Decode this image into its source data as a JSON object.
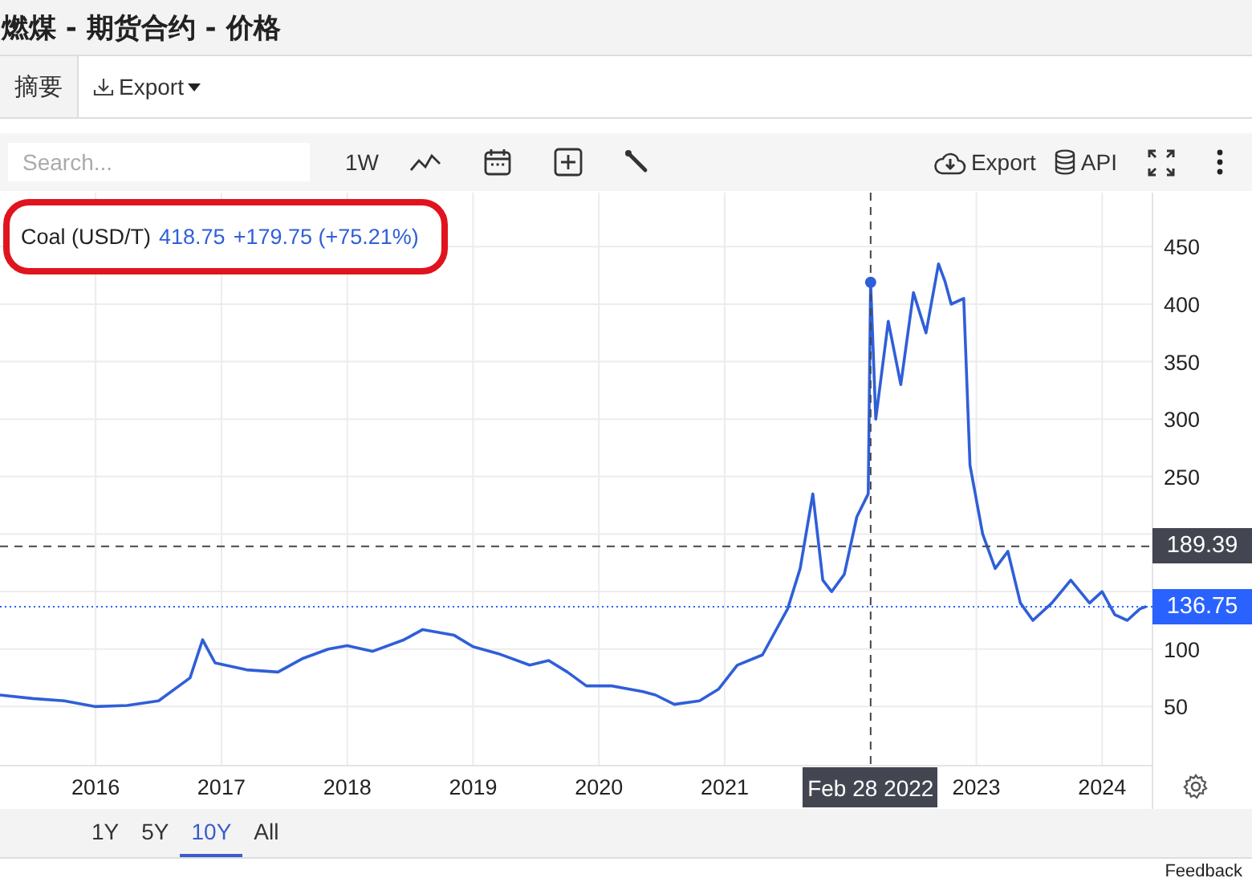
{
  "window": {
    "title": "燃煤 - 期货合约 - 价格"
  },
  "tabs": [
    {
      "label": "摘要",
      "selected": false
    },
    {
      "label": "Export",
      "kind": "dropdown",
      "selected": false
    }
  ],
  "toolbar": {
    "search": {
      "placeholder": "Search..."
    },
    "interval": "1W",
    "export": "Export",
    "api": "API"
  },
  "chart": {
    "legend": {
      "price": "418.75",
      "change": "+179.75 (+75.21%)",
      "highlighted": true
    },
    "chart_data": {
      "type": "line",
      "xlim": [
        2015.24,
        2024.4
      ],
      "ylim": [
        0,
        497
      ],
      "grid": true,
      "xticks": [
        2016,
        2017,
        2018,
        2019,
        2020,
        2021,
        2023,
        2024
      ],
      "yticks": [
        50,
        100,
        250,
        300,
        350,
        400,
        450
      ],
      "series": [
        {
          "name": "Coal (USD/T)",
          "color": "#2f5fd8",
          "values": [
            60,
            57,
            55,
            50,
            51,
            55,
            75,
            108,
            88,
            82,
            80,
            92,
            100,
            103,
            98,
            108,
            117,
            112,
            102,
            96,
            86,
            90,
            80,
            68,
            68,
            63,
            60,
            52,
            55,
            65,
            86,
            95,
            135,
            170,
            235,
            160,
            150,
            165,
            215,
            235,
            419,
            300,
            385,
            330,
            410,
            375,
            435,
            420,
            400,
            405,
            260,
            200,
            170,
            185,
            140,
            125,
            140,
            160,
            140,
            150,
            130,
            125,
            135,
            137
          ]
        }
      ],
      "x": [
        2015.24,
        2015.5,
        2015.75,
        2016.0,
        2016.25,
        2016.5,
        2016.75,
        2016.85,
        2016.95,
        2017.2,
        2017.45,
        2017.65,
        2017.85,
        2018.0,
        2018.2,
        2018.45,
        2018.6,
        2018.85,
        2019.0,
        2019.2,
        2019.45,
        2019.6,
        2019.75,
        2019.9,
        2020.1,
        2020.35,
        2020.45,
        2020.6,
        2020.8,
        2020.95,
        2021.1,
        2021.3,
        2021.5,
        2021.6,
        2021.7,
        2021.78,
        2021.85,
        2021.95,
        2022.05,
        2022.14,
        2022.16,
        2022.2,
        2022.3,
        2022.4,
        2022.5,
        2022.6,
        2022.7,
        2022.75,
        2022.8,
        2022.9,
        2022.95,
        2023.05,
        2023.15,
        2023.25,
        2023.35,
        2023.45,
        2023.6,
        2023.75,
        2023.9,
        2024.0,
        2024.1,
        2024.2,
        2024.3,
        2024.35
      ],
      "ref_lines": [
        {
          "axis": "x",
          "value": 2022.16,
          "label": "Feb 28 2022",
          "color": "#434651"
        },
        {
          "axis": "y",
          "value": 189.39,
          "label": "189.39",
          "color": "#434651"
        },
        {
          "axis": "y",
          "value": 136.75,
          "label": "136.75",
          "color": "#2962ff"
        }
      ]
    }
  },
  "ranges": [
    {
      "label": "1Y",
      "selected": false
    },
    {
      "label": "5Y",
      "selected": false
    },
    {
      "label": "10Y",
      "selected": true
    },
    {
      "label": "All",
      "selected": false
    }
  ],
  "feedback": "Feedback"
}
